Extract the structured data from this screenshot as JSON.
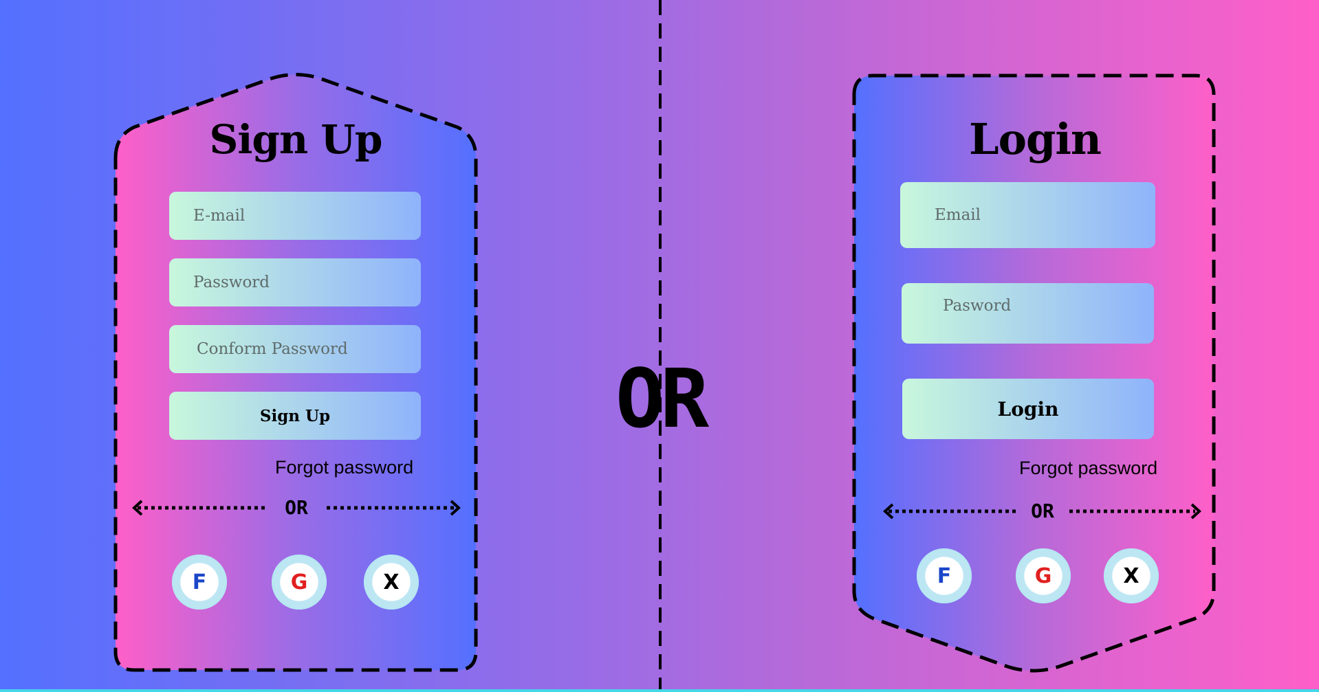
{
  "center": {
    "or_label": "OR"
  },
  "signup": {
    "title": "Sign Up",
    "email_placeholder": "E-mail",
    "password_placeholder": "Password",
    "confirm_placeholder": "Conform Password",
    "button_label": "Sign Up",
    "forgot_label": "Forgot password",
    "separator_label": "OR",
    "social": [
      {
        "label": "F",
        "color": "#1a46c8",
        "icon": "facebook-icon"
      },
      {
        "label": "G",
        "color": "#e0201f",
        "icon": "google-icon"
      },
      {
        "label": "X",
        "color": "#000000",
        "icon": "x-icon"
      }
    ]
  },
  "login": {
    "title": "Login",
    "email_placeholder": "Email",
    "password_placeholder": "Pasword",
    "button_label": "Login",
    "forgot_label": "Forgot password",
    "separator_label": "OR",
    "social": [
      {
        "label": "F",
        "color": "#1a46c8",
        "icon": "facebook-icon"
      },
      {
        "label": "G",
        "color": "#e0201f",
        "icon": "google-icon"
      },
      {
        "label": "X",
        "color": "#000000",
        "icon": "x-icon"
      }
    ]
  },
  "colors": {
    "bg_left": "#5470ff",
    "bg_right": "#ff5fc8",
    "field_start": "#c8f7dc",
    "field_end": "#8fb3fb"
  }
}
